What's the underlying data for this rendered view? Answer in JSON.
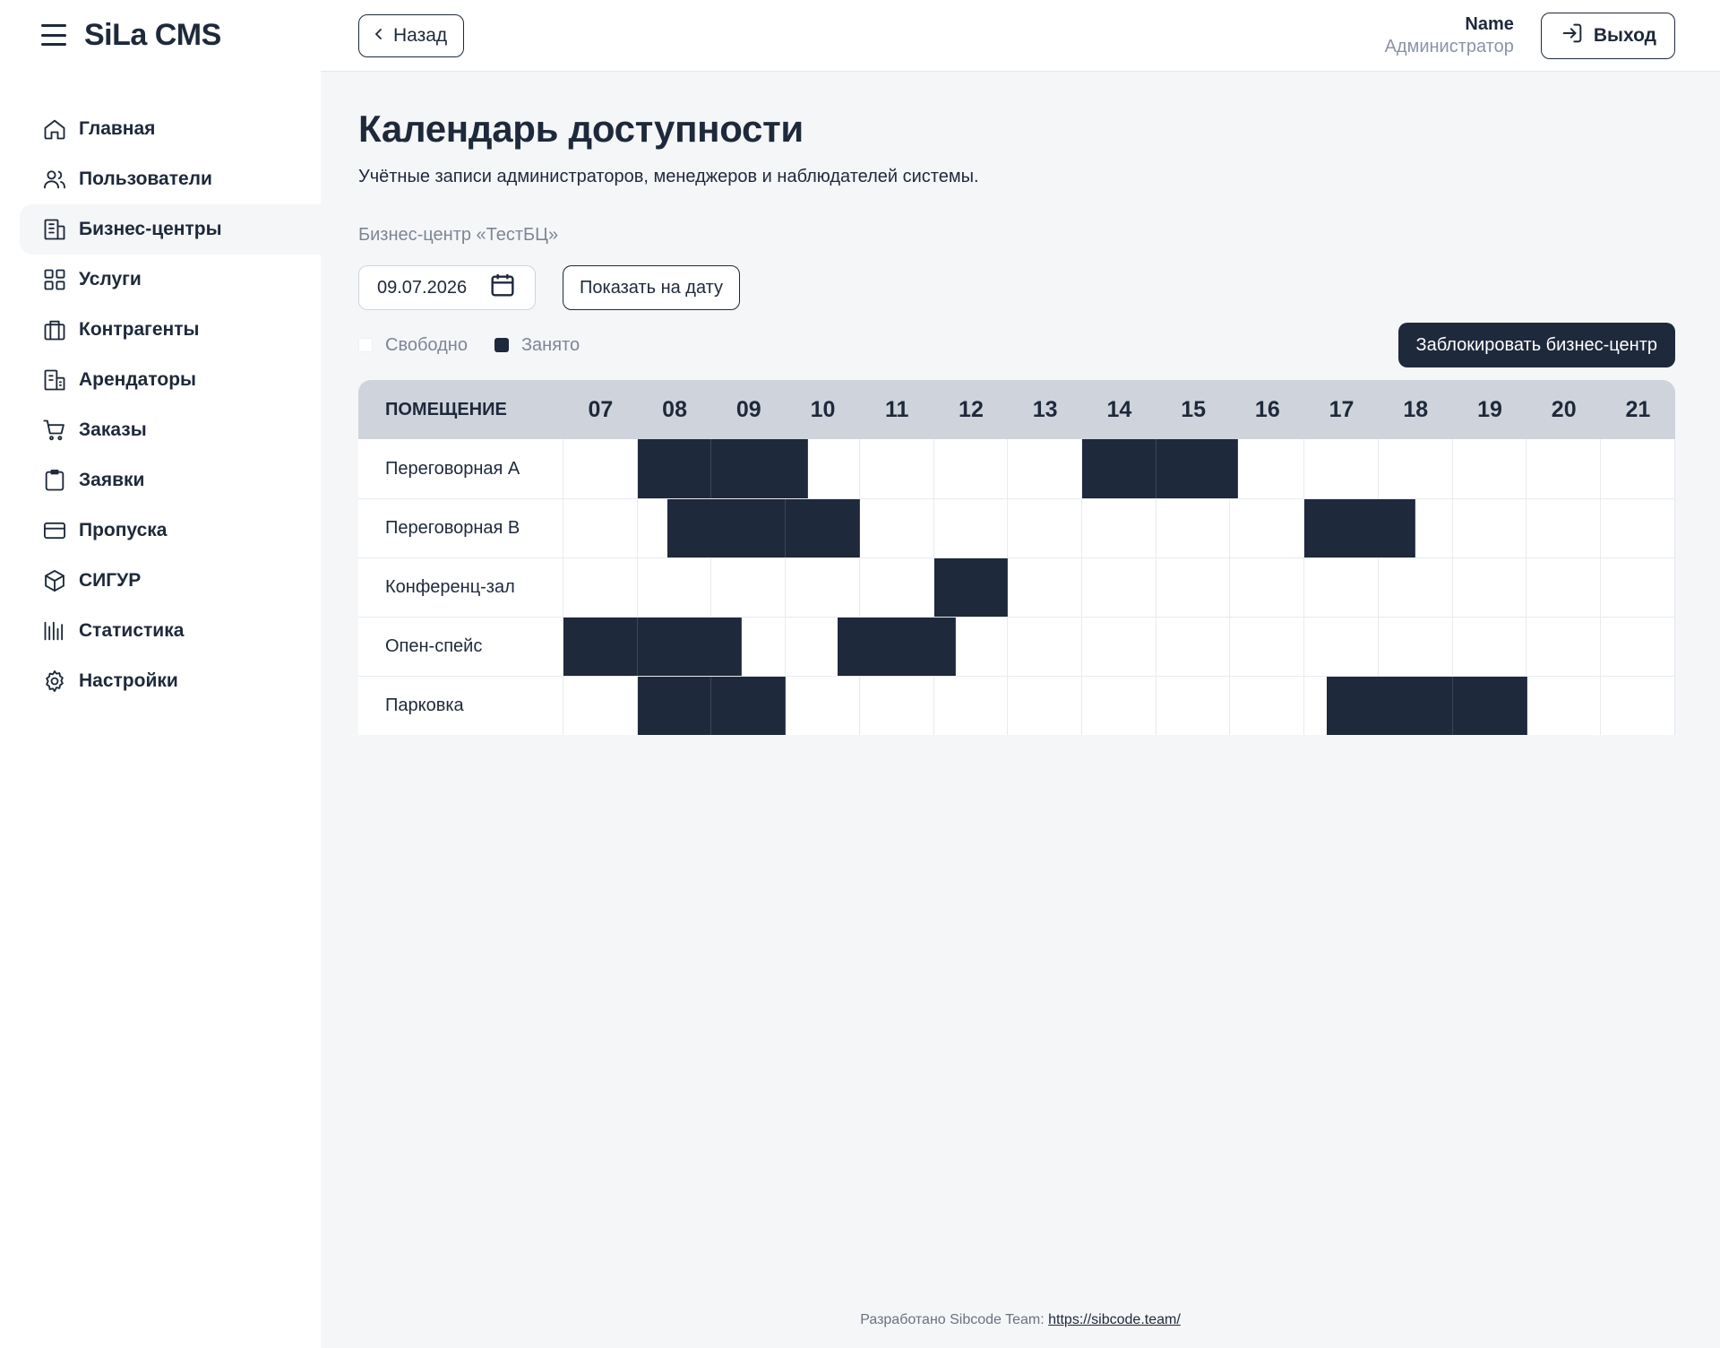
{
  "app": {
    "title": "SiLa CMS"
  },
  "sidebar": {
    "items": [
      {
        "label": "Главная",
        "icon": "home-icon"
      },
      {
        "label": "Пользователи",
        "icon": "users-icon"
      },
      {
        "label": "Бизнес-центры",
        "icon": "building-icon",
        "active": true
      },
      {
        "label": "Услуги",
        "icon": "grid-icon"
      },
      {
        "label": "Контрагенты",
        "icon": "briefcase-icon"
      },
      {
        "label": "Арендаторы",
        "icon": "office-icon"
      },
      {
        "label": "Заказы",
        "icon": "cart-icon"
      },
      {
        "label": "Заявки",
        "icon": "clipboard-icon"
      },
      {
        "label": "Пропуска",
        "icon": "card-icon"
      },
      {
        "label": "СИГУР",
        "icon": "cube-icon"
      },
      {
        "label": "Статистика",
        "icon": "chart-icon"
      },
      {
        "label": "Настройки",
        "icon": "gear-icon"
      }
    ]
  },
  "header": {
    "back_label": "Назад",
    "user_name": "Name",
    "user_role": "Администратор",
    "logout_label": "Выход"
  },
  "page": {
    "title": "Календарь доступности",
    "subtitle": "Учётные записи администраторов, менеджеров и наблюдателей системы.",
    "business_center": "Бизнес-центр «ТестБЦ»",
    "date_value": "09.07.2026",
    "show_button": "Показать на дату",
    "block_button": "Заблокировать бизнес-центр",
    "legend": {
      "free": "Свободно",
      "busy": "Занято"
    }
  },
  "calendar": {
    "room_header": "ПОМЕЩЕНИЕ",
    "hours": [
      "07",
      "08",
      "09",
      "10",
      "11",
      "12",
      "13",
      "14",
      "15",
      "16",
      "17",
      "18",
      "19",
      "20",
      "21"
    ],
    "rooms": [
      {
        "name": "Переговорная A",
        "bookings": [
          [
            8,
            9
          ],
          [
            9,
            10.3
          ],
          [
            14,
            15
          ],
          [
            15,
            16.1
          ]
        ]
      },
      {
        "name": "Переговорная B",
        "bookings": [
          [
            8.4,
            10
          ],
          [
            10,
            11
          ],
          [
            17,
            18.5
          ]
        ]
      },
      {
        "name": "Конференц-зал",
        "bookings": [
          [
            12,
            13
          ]
        ]
      },
      {
        "name": "Опен-спейс",
        "bookings": [
          [
            7,
            8
          ],
          [
            8,
            9.4
          ],
          [
            10.7,
            12.3
          ]
        ]
      },
      {
        "name": "Парковка",
        "bookings": [
          [
            8,
            9
          ],
          [
            9,
            10
          ],
          [
            17.3,
            19
          ],
          [
            19,
            20
          ]
        ]
      }
    ],
    "colors": {
      "busy": "#1e293b",
      "free": "#ffffff"
    }
  },
  "footer": {
    "text": "Разработано Sibcode Team:",
    "link": "https://sibcode.team/"
  }
}
